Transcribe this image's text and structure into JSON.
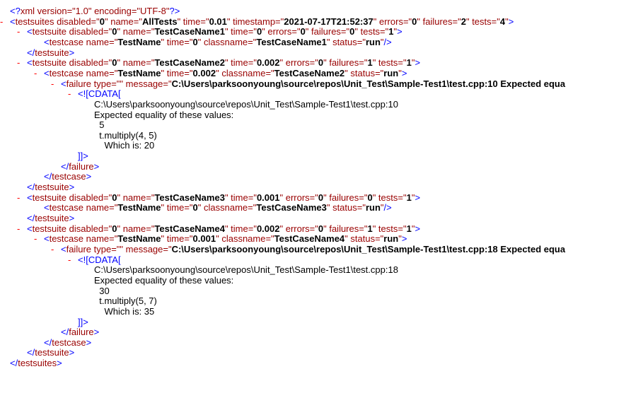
{
  "toggle_symbol": "-",
  "lines": [
    {
      "indent": 0,
      "toggle": false,
      "tokens": [
        {
          "k": "b",
          "s": "<?"
        },
        {
          "k": "t",
          "s": "xml version=\"1.0\" encoding=\"UTF-8\""
        },
        {
          "k": "b",
          "s": "?>"
        }
      ]
    },
    {
      "indent": 0,
      "toggle": true,
      "tokens": [
        {
          "k": "b",
          "s": "<"
        },
        {
          "k": "t",
          "s": "testsuites"
        },
        {
          "k": "a",
          "s": " disabled=\""
        },
        {
          "k": "v",
          "s": "0"
        },
        {
          "k": "a",
          "s": "\" name=\""
        },
        {
          "k": "v",
          "s": "AllTests"
        },
        {
          "k": "a",
          "s": "\" time=\""
        },
        {
          "k": "v",
          "s": "0.01"
        },
        {
          "k": "a",
          "s": "\" timestamp=\""
        },
        {
          "k": "v",
          "s": "2021-07-17T21:52:37"
        },
        {
          "k": "a",
          "s": "\" errors=\""
        },
        {
          "k": "v",
          "s": "0"
        },
        {
          "k": "a",
          "s": "\" failures=\""
        },
        {
          "k": "v",
          "s": "2"
        },
        {
          "k": "a",
          "s": "\" tests=\""
        },
        {
          "k": "v",
          "s": "4"
        },
        {
          "k": "a",
          "s": "\""
        },
        {
          "k": "b",
          "s": ">"
        }
      ]
    },
    {
      "indent": 1,
      "toggle": true,
      "tokens": [
        {
          "k": "b",
          "s": "<"
        },
        {
          "k": "t",
          "s": "testsuite"
        },
        {
          "k": "a",
          "s": " disabled=\""
        },
        {
          "k": "v",
          "s": "0"
        },
        {
          "k": "a",
          "s": "\" name=\""
        },
        {
          "k": "v",
          "s": "TestCaseName1"
        },
        {
          "k": "a",
          "s": "\" time=\""
        },
        {
          "k": "v",
          "s": "0"
        },
        {
          "k": "a",
          "s": "\" errors=\""
        },
        {
          "k": "v",
          "s": "0"
        },
        {
          "k": "a",
          "s": "\" failures=\""
        },
        {
          "k": "v",
          "s": "0"
        },
        {
          "k": "a",
          "s": "\" tests=\""
        },
        {
          "k": "v",
          "s": "1"
        },
        {
          "k": "a",
          "s": "\""
        },
        {
          "k": "b",
          "s": ">"
        }
      ]
    },
    {
      "indent": 2,
      "toggle": false,
      "tokens": [
        {
          "k": "b",
          "s": "<"
        },
        {
          "k": "t",
          "s": "testcase"
        },
        {
          "k": "a",
          "s": " name=\""
        },
        {
          "k": "v",
          "s": "TestName"
        },
        {
          "k": "a",
          "s": "\" time=\""
        },
        {
          "k": "v",
          "s": "0"
        },
        {
          "k": "a",
          "s": "\" classname=\""
        },
        {
          "k": "v",
          "s": "TestCaseName1"
        },
        {
          "k": "a",
          "s": "\" status=\""
        },
        {
          "k": "v",
          "s": "run"
        },
        {
          "k": "a",
          "s": "\""
        },
        {
          "k": "b",
          "s": "/>"
        }
      ]
    },
    {
      "indent": 1,
      "toggle": false,
      "tokens": [
        {
          "k": "b",
          "s": "</"
        },
        {
          "k": "t",
          "s": "testsuite"
        },
        {
          "k": "b",
          "s": ">"
        }
      ]
    },
    {
      "indent": 1,
      "toggle": true,
      "tokens": [
        {
          "k": "b",
          "s": "<"
        },
        {
          "k": "t",
          "s": "testsuite"
        },
        {
          "k": "a",
          "s": " disabled=\""
        },
        {
          "k": "v",
          "s": "0"
        },
        {
          "k": "a",
          "s": "\" name=\""
        },
        {
          "k": "v",
          "s": "TestCaseName2"
        },
        {
          "k": "a",
          "s": "\" time=\""
        },
        {
          "k": "v",
          "s": "0.002"
        },
        {
          "k": "a",
          "s": "\" errors=\""
        },
        {
          "k": "v",
          "s": "0"
        },
        {
          "k": "a",
          "s": "\" failures=\""
        },
        {
          "k": "v",
          "s": "1"
        },
        {
          "k": "a",
          "s": "\" tests=\""
        },
        {
          "k": "v",
          "s": "1"
        },
        {
          "k": "a",
          "s": "\""
        },
        {
          "k": "b",
          "s": ">"
        }
      ]
    },
    {
      "indent": 2,
      "toggle": true,
      "tokens": [
        {
          "k": "b",
          "s": "<"
        },
        {
          "k": "t",
          "s": "testcase"
        },
        {
          "k": "a",
          "s": " name=\""
        },
        {
          "k": "v",
          "s": "TestName"
        },
        {
          "k": "a",
          "s": "\" time=\""
        },
        {
          "k": "v",
          "s": "0.002"
        },
        {
          "k": "a",
          "s": "\" classname=\""
        },
        {
          "k": "v",
          "s": "TestCaseName2"
        },
        {
          "k": "a",
          "s": "\" status=\""
        },
        {
          "k": "v",
          "s": "run"
        },
        {
          "k": "a",
          "s": "\""
        },
        {
          "k": "b",
          "s": ">"
        }
      ]
    },
    {
      "indent": 3,
      "toggle": true,
      "tokens": [
        {
          "k": "b",
          "s": "<"
        },
        {
          "k": "t",
          "s": "failure"
        },
        {
          "k": "a",
          "s": " type=\""
        },
        {
          "k": "v",
          "s": ""
        },
        {
          "k": "a",
          "s": "\" message=\""
        },
        {
          "k": "v",
          "s": "C:\\Users\\parksoonyoung\\source\\repos\\Unit_Test\\Sample-Test1\\test.cpp:10 Expected equa"
        }
      ]
    },
    {
      "indent": 4,
      "toggle": true,
      "tokens": [
        {
          "k": "b",
          "s": "<![CDATA["
        }
      ]
    },
    {
      "indent": 5,
      "toggle": false,
      "tokens": [
        {
          "k": "c",
          "s": "C:\\Users\\parksoonyoung\\source\\repos\\Unit_Test\\Sample-Test1\\test.cpp:10"
        }
      ]
    },
    {
      "indent": 5,
      "toggle": false,
      "tokens": [
        {
          "k": "c",
          "s": "Expected equality of these values:"
        }
      ]
    },
    {
      "indent": 5,
      "toggle": false,
      "tokens": [
        {
          "k": "c",
          "s": "  5"
        }
      ]
    },
    {
      "indent": 5,
      "toggle": false,
      "tokens": [
        {
          "k": "c",
          "s": "  t.multiply(4, 5)"
        }
      ]
    },
    {
      "indent": 5,
      "toggle": false,
      "tokens": [
        {
          "k": "c",
          "s": "    Which is: 20"
        }
      ]
    },
    {
      "indent": 4,
      "toggle": false,
      "tokens": [
        {
          "k": "b",
          "s": "]]>"
        }
      ]
    },
    {
      "indent": 3,
      "toggle": false,
      "tokens": [
        {
          "k": "b",
          "s": "</"
        },
        {
          "k": "t",
          "s": "failure"
        },
        {
          "k": "b",
          "s": ">"
        }
      ]
    },
    {
      "indent": 2,
      "toggle": false,
      "tokens": [
        {
          "k": "b",
          "s": "</"
        },
        {
          "k": "t",
          "s": "testcase"
        },
        {
          "k": "b",
          "s": ">"
        }
      ]
    },
    {
      "indent": 1,
      "toggle": false,
      "tokens": [
        {
          "k": "b",
          "s": "</"
        },
        {
          "k": "t",
          "s": "testsuite"
        },
        {
          "k": "b",
          "s": ">"
        }
      ]
    },
    {
      "indent": 1,
      "toggle": true,
      "tokens": [
        {
          "k": "b",
          "s": "<"
        },
        {
          "k": "t",
          "s": "testsuite"
        },
        {
          "k": "a",
          "s": " disabled=\""
        },
        {
          "k": "v",
          "s": "0"
        },
        {
          "k": "a",
          "s": "\" name=\""
        },
        {
          "k": "v",
          "s": "TestCaseName3"
        },
        {
          "k": "a",
          "s": "\" time=\""
        },
        {
          "k": "v",
          "s": "0.001"
        },
        {
          "k": "a",
          "s": "\" errors=\""
        },
        {
          "k": "v",
          "s": "0"
        },
        {
          "k": "a",
          "s": "\" failures=\""
        },
        {
          "k": "v",
          "s": "0"
        },
        {
          "k": "a",
          "s": "\" tests=\""
        },
        {
          "k": "v",
          "s": "1"
        },
        {
          "k": "a",
          "s": "\""
        },
        {
          "k": "b",
          "s": ">"
        }
      ]
    },
    {
      "indent": 2,
      "toggle": false,
      "tokens": [
        {
          "k": "b",
          "s": "<"
        },
        {
          "k": "t",
          "s": "testcase"
        },
        {
          "k": "a",
          "s": " name=\""
        },
        {
          "k": "v",
          "s": "TestName"
        },
        {
          "k": "a",
          "s": "\" time=\""
        },
        {
          "k": "v",
          "s": "0"
        },
        {
          "k": "a",
          "s": "\" classname=\""
        },
        {
          "k": "v",
          "s": "TestCaseName3"
        },
        {
          "k": "a",
          "s": "\" status=\""
        },
        {
          "k": "v",
          "s": "run"
        },
        {
          "k": "a",
          "s": "\""
        },
        {
          "k": "b",
          "s": "/>"
        }
      ]
    },
    {
      "indent": 1,
      "toggle": false,
      "tokens": [
        {
          "k": "b",
          "s": "</"
        },
        {
          "k": "t",
          "s": "testsuite"
        },
        {
          "k": "b",
          "s": ">"
        }
      ]
    },
    {
      "indent": 1,
      "toggle": true,
      "tokens": [
        {
          "k": "b",
          "s": "<"
        },
        {
          "k": "t",
          "s": "testsuite"
        },
        {
          "k": "a",
          "s": " disabled=\""
        },
        {
          "k": "v",
          "s": "0"
        },
        {
          "k": "a",
          "s": "\" name=\""
        },
        {
          "k": "v",
          "s": "TestCaseName4"
        },
        {
          "k": "a",
          "s": "\" time=\""
        },
        {
          "k": "v",
          "s": "0.002"
        },
        {
          "k": "a",
          "s": "\" errors=\""
        },
        {
          "k": "v",
          "s": "0"
        },
        {
          "k": "a",
          "s": "\" failures=\""
        },
        {
          "k": "v",
          "s": "1"
        },
        {
          "k": "a",
          "s": "\" tests=\""
        },
        {
          "k": "v",
          "s": "1"
        },
        {
          "k": "a",
          "s": "\""
        },
        {
          "k": "b",
          "s": ">"
        }
      ]
    },
    {
      "indent": 2,
      "toggle": true,
      "tokens": [
        {
          "k": "b",
          "s": "<"
        },
        {
          "k": "t",
          "s": "testcase"
        },
        {
          "k": "a",
          "s": " name=\""
        },
        {
          "k": "v",
          "s": "TestName"
        },
        {
          "k": "a",
          "s": "\" time=\""
        },
        {
          "k": "v",
          "s": "0.001"
        },
        {
          "k": "a",
          "s": "\" classname=\""
        },
        {
          "k": "v",
          "s": "TestCaseName4"
        },
        {
          "k": "a",
          "s": "\" status=\""
        },
        {
          "k": "v",
          "s": "run"
        },
        {
          "k": "a",
          "s": "\""
        },
        {
          "k": "b",
          "s": ">"
        }
      ]
    },
    {
      "indent": 3,
      "toggle": true,
      "tokens": [
        {
          "k": "b",
          "s": "<"
        },
        {
          "k": "t",
          "s": "failure"
        },
        {
          "k": "a",
          "s": " type=\""
        },
        {
          "k": "v",
          "s": ""
        },
        {
          "k": "a",
          "s": "\" message=\""
        },
        {
          "k": "v",
          "s": "C:\\Users\\parksoonyoung\\source\\repos\\Unit_Test\\Sample-Test1\\test.cpp:18 Expected equa"
        }
      ]
    },
    {
      "indent": 4,
      "toggle": true,
      "tokens": [
        {
          "k": "b",
          "s": "<![CDATA["
        }
      ]
    },
    {
      "indent": 5,
      "toggle": false,
      "tokens": [
        {
          "k": "c",
          "s": "C:\\Users\\parksoonyoung\\source\\repos\\Unit_Test\\Sample-Test1\\test.cpp:18"
        }
      ]
    },
    {
      "indent": 5,
      "toggle": false,
      "tokens": [
        {
          "k": "c",
          "s": "Expected equality of these values:"
        }
      ]
    },
    {
      "indent": 5,
      "toggle": false,
      "tokens": [
        {
          "k": "c",
          "s": "  30"
        }
      ]
    },
    {
      "indent": 5,
      "toggle": false,
      "tokens": [
        {
          "k": "c",
          "s": "  t.multiply(5, 7)"
        }
      ]
    },
    {
      "indent": 5,
      "toggle": false,
      "tokens": [
        {
          "k": "c",
          "s": "    Which is: 35"
        }
      ]
    },
    {
      "indent": 4,
      "toggle": false,
      "tokens": [
        {
          "k": "b",
          "s": "]]>"
        }
      ]
    },
    {
      "indent": 3,
      "toggle": false,
      "tokens": [
        {
          "k": "b",
          "s": "</"
        },
        {
          "k": "t",
          "s": "failure"
        },
        {
          "k": "b",
          "s": ">"
        }
      ]
    },
    {
      "indent": 2,
      "toggle": false,
      "tokens": [
        {
          "k": "b",
          "s": "</"
        },
        {
          "k": "t",
          "s": "testcase"
        },
        {
          "k": "b",
          "s": ">"
        }
      ]
    },
    {
      "indent": 1,
      "toggle": false,
      "tokens": [
        {
          "k": "b",
          "s": "</"
        },
        {
          "k": "t",
          "s": "testsuite"
        },
        {
          "k": "b",
          "s": ">"
        }
      ]
    },
    {
      "indent": 0,
      "toggle": false,
      "tokens": [
        {
          "k": "b",
          "s": "</"
        },
        {
          "k": "t",
          "s": "testsuites"
        },
        {
          "k": "b",
          "s": ">"
        }
      ]
    }
  ]
}
